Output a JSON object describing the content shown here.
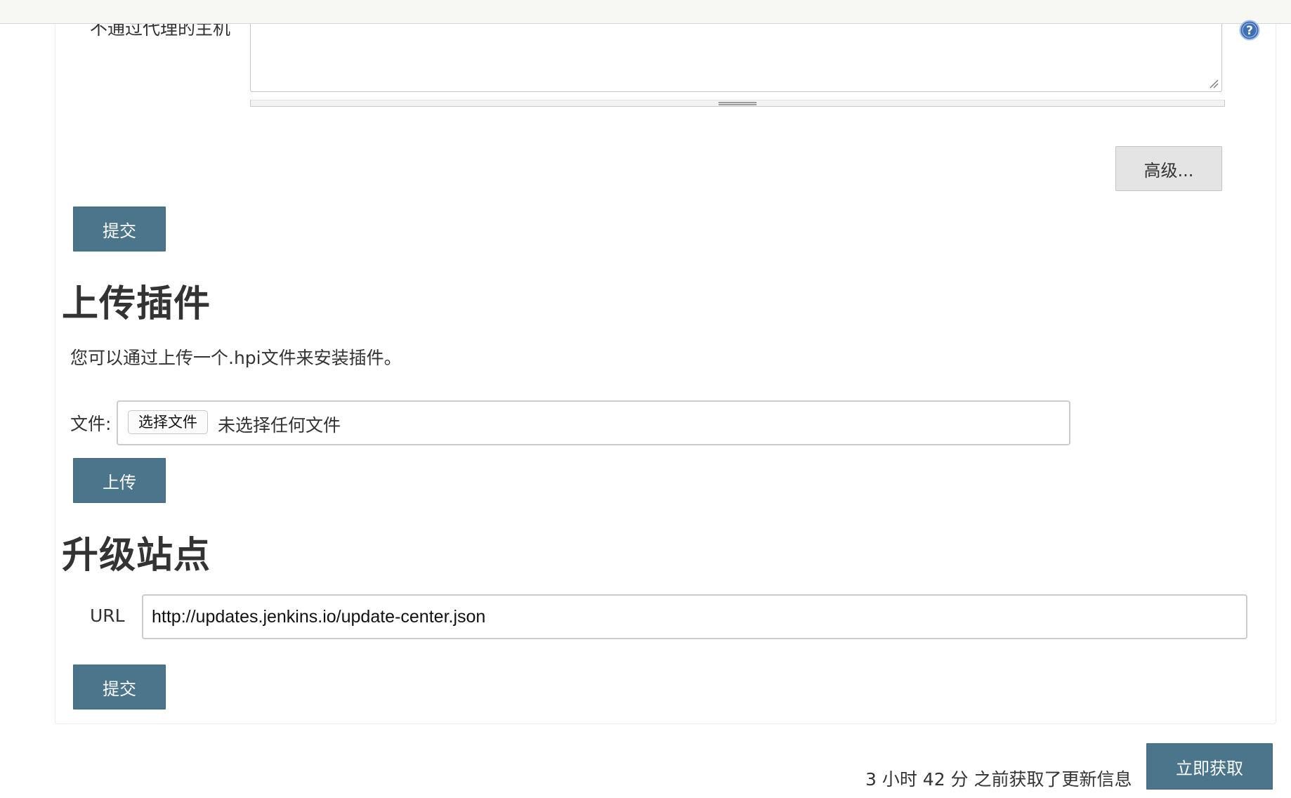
{
  "proxy": {
    "no_proxy_label": "不通过代理的主机",
    "no_proxy_value": "",
    "advanced_label": "高级...",
    "submit_label": "提交"
  },
  "upload_plugin": {
    "title": "上传插件",
    "description": "您可以通过上传一个.hpi文件来安装插件。",
    "file_label": "文件:",
    "choose_file_label": "选择文件",
    "no_file_text": "未选择任何文件",
    "upload_label": "上传"
  },
  "update_site": {
    "title": "升级站点",
    "url_label": "URL",
    "url_value": "http://updates.jenkins.io/update-center.json",
    "submit_label": "提交"
  },
  "footer": {
    "last_update_text": "3 小时 42 分 之前获取了更新信息",
    "check_now_label": "立即获取"
  },
  "colors": {
    "primary_button": "#4b758b",
    "secondary_button": "#e4e4e4",
    "help_icon": "#3d6fb6"
  },
  "icons": {
    "help": "help-icon",
    "resize": "resize-grip-icon"
  }
}
